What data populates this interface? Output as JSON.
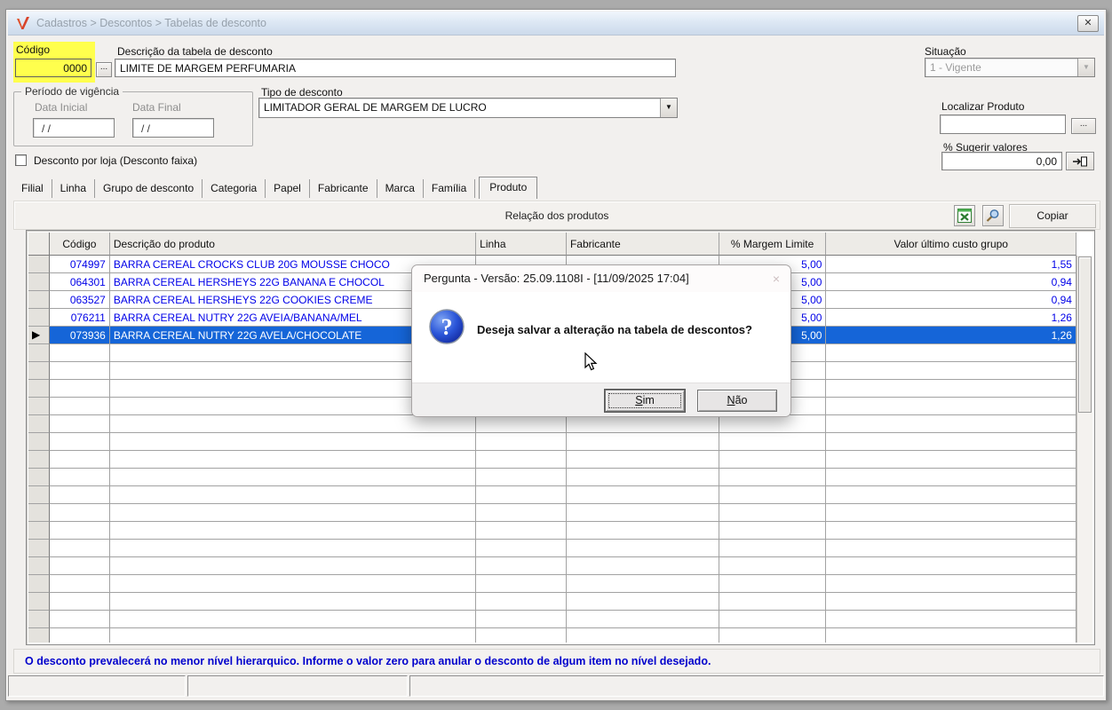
{
  "window": {
    "title": "Cadastros > Descontos > Tabelas de desconto",
    "close_glyph": "✕"
  },
  "form": {
    "codigo": {
      "label": "Código",
      "value": "0000",
      "browse_label": "..."
    },
    "descricao": {
      "label": "Descrição da tabela de desconto",
      "value": "LIMITE DE MARGEM PERFUMARIA"
    },
    "situacao": {
      "label": "Situação",
      "value": "1 - Vigente"
    },
    "periodo": {
      "legend": "Período de vigência",
      "data_inicial_label": "Data Inicial",
      "data_inicial_value": "/  /",
      "data_final_label": "Data Final",
      "data_final_value": "/  /"
    },
    "tipo_desconto": {
      "label": "Tipo de desconto",
      "value": "LIMITADOR GERAL DE MARGEM DE LUCRO"
    },
    "localizar_produto": {
      "label": "Localizar Produto",
      "value": "",
      "browse_label": "..."
    },
    "sugerir_valores": {
      "label": "% Sugerir valores",
      "value": "0,00"
    },
    "desconto_loja": {
      "label": "Desconto por loja (Desconto faixa)",
      "checked": false
    }
  },
  "tabs": {
    "items": [
      "Filial",
      "Linha",
      "Grupo de desconto",
      "Categoria",
      "Papel",
      "Fabricante",
      "Marca",
      "Família",
      "Produto"
    ],
    "active": "Produto"
  },
  "toolbar": {
    "caption": "Relação dos produtos",
    "copy_label": "Copiar",
    "icons": [
      "excel-export-icon",
      "search-icon"
    ]
  },
  "table": {
    "columns": [
      "Código",
      "Descrição do produto",
      "Linha",
      "Fabricante",
      "% Margem Limite",
      "Valor último custo grupo"
    ],
    "rows": [
      {
        "codigo": "074997",
        "descricao": "BARRA CEREAL CROCKS CLUB 20G MOUSSE CHOCO",
        "linha": "",
        "fabricante": "",
        "margem": "5,00",
        "valor": "1,55",
        "selected": false
      },
      {
        "codigo": "064301",
        "descricao": "BARRA CEREAL HERSHEYS 22G BANANA E CHOCOL",
        "linha": "",
        "fabricante": "",
        "margem": "5,00",
        "valor": "0,94",
        "selected": false
      },
      {
        "codigo": "063527",
        "descricao": "BARRA CEREAL HERSHEYS 22G COOKIES CREME",
        "linha": "",
        "fabricante": "",
        "margem": "5,00",
        "valor": "0,94",
        "selected": false
      },
      {
        "codigo": "076211",
        "descricao": "BARRA CEREAL NUTRY 22G AVEIA/BANANA/MEL",
        "linha": "",
        "fabricante": "",
        "margem": "5,00",
        "valor": "1,26",
        "selected": false
      },
      {
        "codigo": "073936",
        "descricao": "BARRA CEREAL NUTRY 22G AVELA/CHOCOLATE",
        "linha": "",
        "fabricante": "",
        "margem": "5,00",
        "valor": "1,26",
        "selected": true
      }
    ],
    "empty_row_count": 17
  },
  "notice": {
    "text": "O desconto prevalecerá no menor nível hierarquico. Informe o valor zero para anular o desconto de algum item no nível desejado."
  },
  "dialog": {
    "title": "Pergunta - Versão: 25.09.1108I - [11/09/2025 17:04]",
    "close_glyph": "×",
    "message": "Deseja salvar a alteração na tabela de descontos?",
    "buttons": [
      {
        "label": "Sim",
        "accesskey": "S",
        "focused": true
      },
      {
        "label": "Não",
        "accesskey": "N",
        "focused": false
      }
    ]
  },
  "colors": {
    "selection": "#1565d8",
    "data_text": "#0000e8",
    "notice_text": "#0000cc",
    "highlight_yellow": "#ffff4d",
    "titlebar_gradient_top": "#f1f6fc",
    "titlebar_gradient_bottom": "#ccdaeb"
  }
}
